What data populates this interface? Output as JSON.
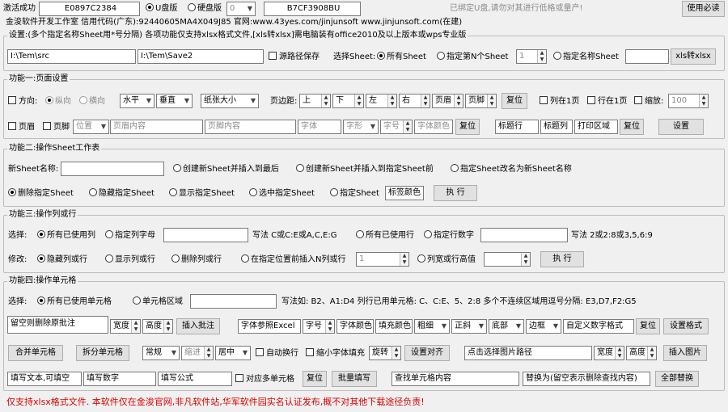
{
  "header": {
    "activate_label": "激活成功",
    "serial1": "E0897C2384",
    "udisk": "U盘版",
    "hdisk": "硬盘版",
    "hd_num": "0",
    "serial2": "B7CF3908BU",
    "bound_notice": "已绑定U盘,请勿对其进行低格或量产!",
    "help_button": "使用必读",
    "company_line": "金浚软件开发工作室 信用代码(广东):92440605MA4X049J85 官网:www.43yes.com/jinjunsoft  www.jinjunsoft.com(在建)"
  },
  "settings": {
    "title": "设置:(多个指定名称Sheet用*号分隔) 各项功能仅支持xlsx格式文件,[xls转xlsx]需电脑装有office2010及以上版本或wps专业版",
    "src_path": "I:\\Tem\\src",
    "save_path": "I:\\Tem\\Save2",
    "keep_src": "源路径保存",
    "select_sheet": "选择Sheet:",
    "all_sheet": "所有Sheet",
    "nth_sheet": "指定第N个Sheet",
    "nth_value": "1",
    "named_sheet": "指定名称Sheet",
    "xls_button": "xls转xlsx"
  },
  "f1": {
    "title": "功能一:页面设置",
    "orientation": "方向:",
    "portrait": "纵向",
    "landscape": "横向",
    "h_align": "水平",
    "v_align": "垂直",
    "paper": "纸张大小",
    "margin": "页边距:",
    "top": "上",
    "bottom": "下",
    "left": "左",
    "right": "右",
    "header_m": "页眉",
    "footer_m": "页脚",
    "reset": "复位",
    "col_one_page": "列在1页",
    "row_one_page": "行在1页",
    "zoom": "缩放:",
    "zoom_value": "100",
    "header_chk": "页眉",
    "footer_chk": "页脚",
    "position": "位置",
    "header_content": "页眉内容",
    "footer_content": "页脚内容",
    "font": "字体",
    "font_style": "字形",
    "font_size": "字号",
    "font_color": "字体颜色",
    "reset2": "复位",
    "title_row": "标题行",
    "title_col": "标题列",
    "print_area": "打印区域",
    "reset3": "复位",
    "apply": "设置"
  },
  "f2": {
    "title": "功能二:操作Sheet工作表",
    "new_name": "新Sheet名称:",
    "opt1": "创建新Sheet并插入到最后",
    "opt2": "创建新Sheet并插入到指定Sheet前",
    "opt3": "指定Sheet改名为新Sheet名称",
    "opt4": "删除指定Sheet",
    "opt5": "隐藏指定Sheet",
    "opt6": "显示指定Sheet",
    "opt7": "选中指定Sheet",
    "opt8": "指定Sheet",
    "tab_color": "标签颜色",
    "execute": "执 行"
  },
  "f3": {
    "title": "功能三:操作列或行",
    "select": "选择:",
    "used_cols": "所有已使用列",
    "spec_cols": "指定列字母",
    "col_hint": "写法 C或C:E或A,C,E:G",
    "used_rows": "所有已使用行",
    "spec_rows": "指定行数字",
    "row_hint": "写法 2或2:8或3,5,6:9",
    "modify": "修改:",
    "hide": "隐藏列或行",
    "show": "显示列或行",
    "delete": "删除列或行",
    "insert": "在指定位置前插入N列或行",
    "insert_n": "1",
    "width": "列宽或行高值",
    "execute": "执 行"
  },
  "f4": {
    "title": "功能四:操作单元格",
    "select": "选择:",
    "used_cells": "所有已使用单元格",
    "range": "单元格区域",
    "hint": "写法如: B2、A1:D4  列行已用单元格: C、C:E、5、2:8  多个不连续区域用逗号分隔: E3,D7,F2:G5",
    "comment_text": "留空则删除原批注",
    "width": "宽度",
    "height": "高度",
    "insert_comment": "插入批注",
    "font_ref": "字体参照Excel",
    "font_size": "字号",
    "font_color": "字体颜色",
    "fill_color": "填充颜色",
    "bold": "粗细",
    "italic": "正斜",
    "valign": "底部",
    "border": "边框",
    "custom_fmt": "自定义数字格式",
    "reset": "复位",
    "set_format": "设置格式",
    "merge": "合并单元格",
    "unmerge": "拆分单元格",
    "normal": "常规",
    "indent": "缩进",
    "center": "居中",
    "wrap": "自动换行",
    "shrink": "缩小字体填充",
    "rotate": "旋转",
    "set_align": "设置对齐",
    "img_path": "点击选择图片路径",
    "img_w": "宽度",
    "img_h": "高度",
    "insert_img": "插入图片",
    "fill_text": "填写文本,可填空",
    "fill_num": "填写数字",
    "fill_formula": "填写公式",
    "each_cell": "对应多单元格",
    "reset2": "复位",
    "batch_fill": "批量填写",
    "find": "查找单元格内容",
    "replace": "替换为(留空表示删除查找内容)",
    "replace_all": "全部替换"
  },
  "footer": {
    "notice": "仅支持xlsx格式文件. 本软件仅在金浚官网,非凡软件站,华军软件园实名认证发布,概不对其他下载途径负责!"
  },
  "colors": {
    "footer_red": "#d80000",
    "bound_gray": "#8a8a8a"
  }
}
